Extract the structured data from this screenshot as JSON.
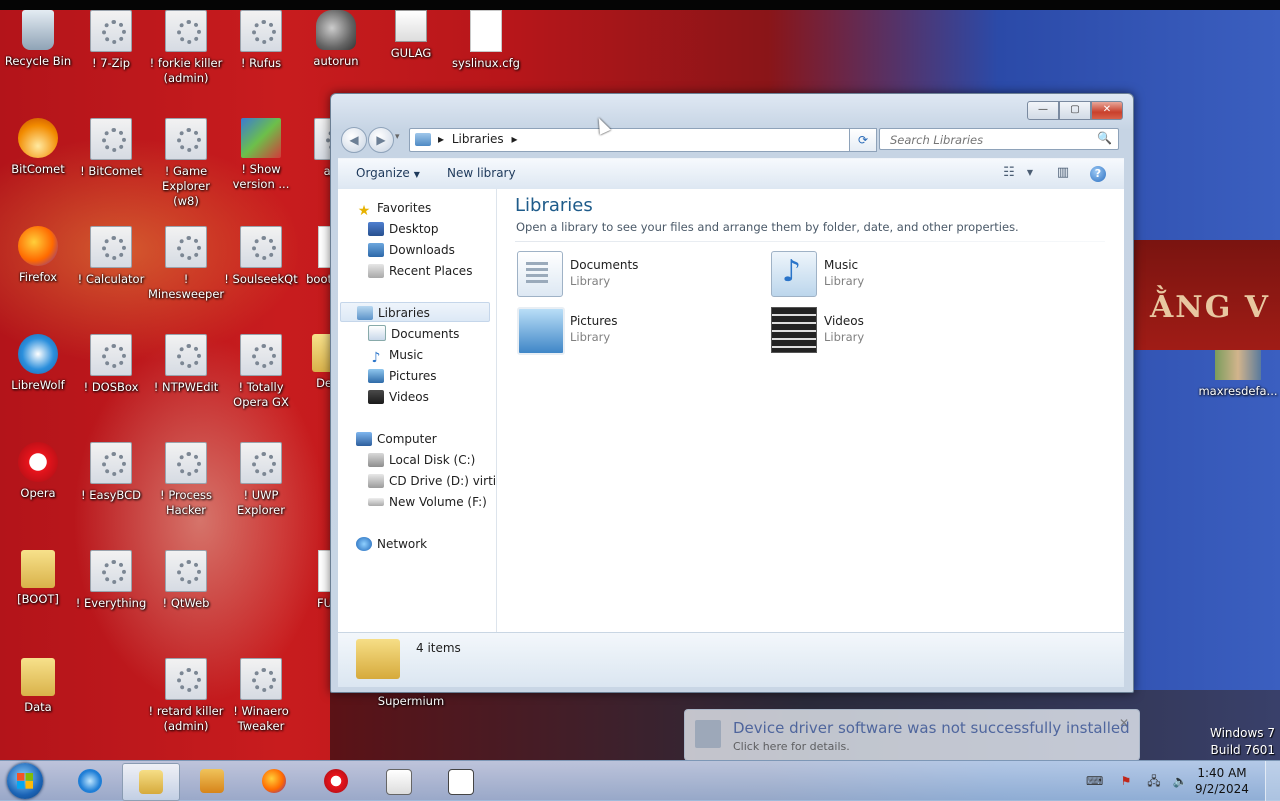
{
  "desktop": {
    "banner_text": "ẰNG V",
    "icons": [
      {
        "label": "Recycle Bin"
      },
      {
        "label": "! 7-Zip"
      },
      {
        "label": "! forkie killer (admin)"
      },
      {
        "label": "! Rufus"
      },
      {
        "label": "autorun"
      },
      {
        "label": "GULAG"
      },
      {
        "label": "syslinux.cfg"
      },
      {
        "label": "BitComet"
      },
      {
        "label": "! BitComet"
      },
      {
        "label": "! Game Explorer (w8)"
      },
      {
        "label": "! Show version ..."
      },
      {
        "label": "au"
      },
      {
        "label": "Firefox"
      },
      {
        "label": "! Calculator"
      },
      {
        "label": "! Minesweeper"
      },
      {
        "label": "! SoulseekQt"
      },
      {
        "label": "boot"
      },
      {
        "label": "LibreWolf"
      },
      {
        "label": "! DOSBox"
      },
      {
        "label": "! NTPWEdit"
      },
      {
        "label": "! Totally Opera GX"
      },
      {
        "label": "De"
      },
      {
        "label": "Opera"
      },
      {
        "label": "! EasyBCD"
      },
      {
        "label": "! Process Hacker"
      },
      {
        "label": "! UWP Explorer"
      },
      {
        "label": "[BOOT]"
      },
      {
        "label": "! Everything"
      },
      {
        "label": "! QtWeb"
      },
      {
        "label": "FU"
      },
      {
        "label": "Data"
      },
      {
        "label": "! retard killer (admin)"
      },
      {
        "label": "! Winaero Tweaker"
      },
      {
        "label": "Supermium"
      },
      {
        "label": "maxresdefa..."
      }
    ]
  },
  "window": {
    "caption_buttons": {
      "minimize": "—",
      "maximize": "▢",
      "close": "✕"
    },
    "nav": {
      "back": "◀",
      "forward": "▶",
      "history": "▾"
    },
    "address": {
      "crumb": "Libraries",
      "sep1": "▸",
      "sep2": "▸",
      "dropdown": "▼"
    },
    "refresh": "⟳",
    "search": {
      "placeholder": "Search Libraries",
      "icon": "🔍"
    },
    "commands": {
      "organize": "Organize",
      "new_library": "New library",
      "arrow": "▼",
      "view_arrow": "▼"
    },
    "nav_pane": {
      "favorites": "Favorites",
      "desktop": "Desktop",
      "downloads": "Downloads",
      "recent_places": "Recent Places",
      "libraries": "Libraries",
      "documents": "Documents",
      "music": "Music",
      "pictures": "Pictures",
      "videos": "Videos",
      "computer": "Computer",
      "local_disk": "Local Disk (C:)",
      "cd_drive": "CD Drive (D:) virtio-w",
      "new_volume": "New Volume (F:)",
      "network": "Network"
    },
    "main": {
      "title": "Libraries",
      "subtitle": "Open a library to see your files and arrange them by folder, date, and other properties.",
      "items": [
        {
          "name": "Documents",
          "type": "Library"
        },
        {
          "name": "Music",
          "type": "Library"
        },
        {
          "name": "Pictures",
          "type": "Library"
        },
        {
          "name": "Videos",
          "type": "Library"
        }
      ]
    },
    "details": {
      "count": "4 items"
    }
  },
  "notification": {
    "title": "Device driver software was not successfully installed",
    "subtitle": "Click here for details.",
    "close": "✕"
  },
  "watermark": {
    "line1": "Windows 7",
    "line2": "Build 7601"
  },
  "taskbar": {
    "clock_time": "1:40 AM",
    "clock_date": "9/2/2024",
    "tray": {
      "keyboard": "⌨",
      "flag": "⚑",
      "network": "🖧",
      "volume": "🔈"
    }
  },
  "colors": {
    "accent": "#1e5b8a",
    "taskbar": "#a9c3e2",
    "desktop_red": "#c81c1e"
  }
}
